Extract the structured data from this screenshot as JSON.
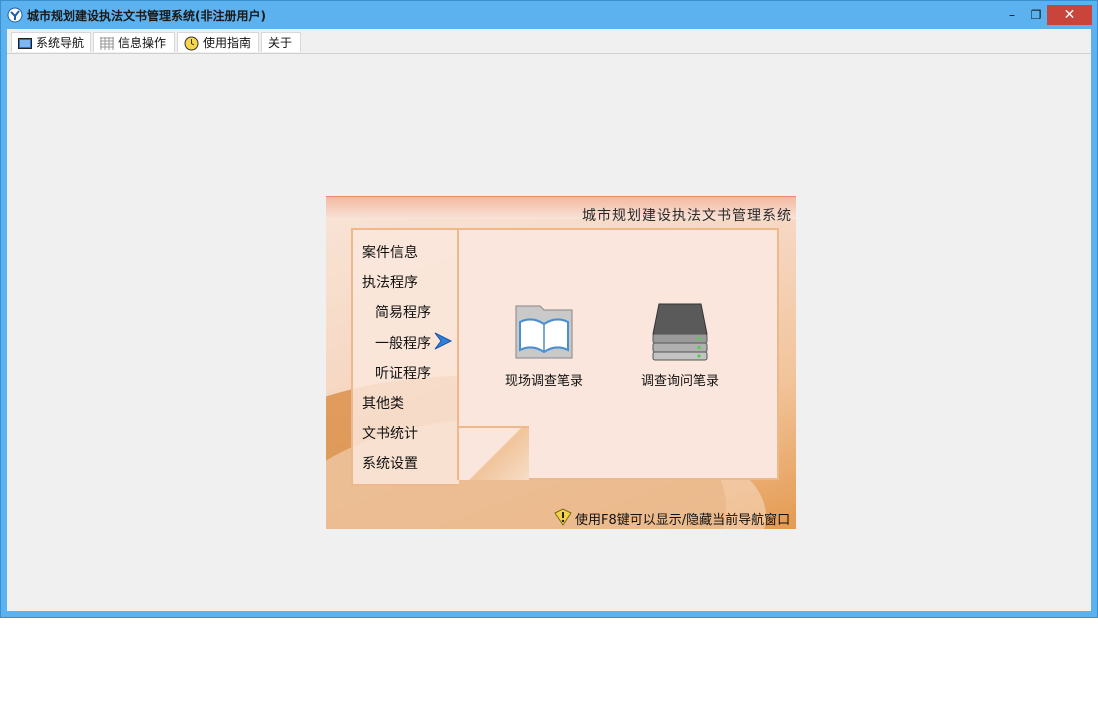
{
  "window": {
    "title": "城市规划建设执法文书管理系统(非注册用户)",
    "controls": {
      "minimize": "–",
      "restore": "❐",
      "close": "✕"
    }
  },
  "tabs": [
    {
      "label": "系统导航",
      "icon": "monitor-icon"
    },
    {
      "label": "信息操作",
      "icon": "grid-icon"
    },
    {
      "label": "使用指南",
      "icon": "clock-icon"
    },
    {
      "label": "关于",
      "icon": ""
    }
  ],
  "panel": {
    "title": "城市规划建设执法文书管理系统",
    "menu": {
      "case_info": "案件信息",
      "procedure": "执法程序",
      "simple": "简易程序",
      "general": "一般程序",
      "hearing": "听证程序",
      "other": "其他类",
      "stats": "文书统计",
      "settings": "系统设置"
    },
    "launchers": [
      {
        "label": "现场调查笔录",
        "icon": "book-icon"
      },
      {
        "label": "调查询问笔录",
        "icon": "drive-icon"
      }
    ],
    "hint": "使用F8键可以显示/隐藏当前导航窗口"
  },
  "colors": {
    "titlebar": "#5cb2ee",
    "close": "#c9443a",
    "client": "#f0f0f0"
  }
}
